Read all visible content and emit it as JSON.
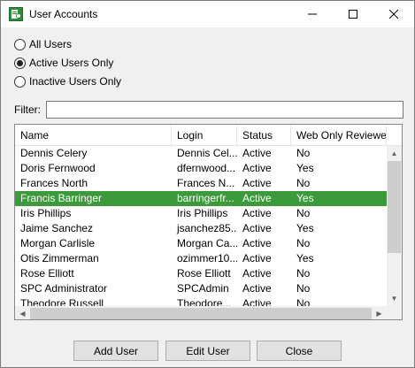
{
  "window": {
    "title": "User Accounts",
    "icon": "user-accounts-app-icon",
    "controls": [
      "minimize-icon",
      "maximize-icon",
      "close-icon"
    ]
  },
  "filters": {
    "options": [
      {
        "label": "All Users",
        "checked": false
      },
      {
        "label": "Active Users Only",
        "checked": true
      },
      {
        "label": "Inactive Users Only",
        "checked": false
      }
    ],
    "filter_label": "Filter:",
    "filter_value": ""
  },
  "table": {
    "columns": [
      "Name",
      "Login",
      "Status",
      "Web Only Reviewer"
    ],
    "rows": [
      {
        "name": "Dennis Celery",
        "login": "Dennis Cel...",
        "status": "Active",
        "reviewer": "No",
        "selected": false
      },
      {
        "name": "Doris Fernwood",
        "login": "dfernwood...",
        "status": "Active",
        "reviewer": "Yes",
        "selected": false
      },
      {
        "name": "Frances North",
        "login": "Frances N...",
        "status": "Active",
        "reviewer": "No",
        "selected": false
      },
      {
        "name": "Francis Barringer",
        "login": "barringerfr...",
        "status": "Active",
        "reviewer": "Yes",
        "selected": true
      },
      {
        "name": "Iris Phillips",
        "login": "Iris Phillips",
        "status": "Active",
        "reviewer": "No",
        "selected": false
      },
      {
        "name": "Jaime Sanchez",
        "login": "jsanchez85...",
        "status": "Active",
        "reviewer": "Yes",
        "selected": false
      },
      {
        "name": "Morgan Carlisle",
        "login": "Morgan Ca...",
        "status": "Active",
        "reviewer": "No",
        "selected": false
      },
      {
        "name": "Otis Zimmerman",
        "login": "ozimmer10...",
        "status": "Active",
        "reviewer": "Yes",
        "selected": false
      },
      {
        "name": "Rose Elliott",
        "login": "Rose Elliott",
        "status": "Active",
        "reviewer": "No",
        "selected": false
      },
      {
        "name": "SPC Administrator",
        "login": "SPCAdmin",
        "status": "Active",
        "reviewer": "No",
        "selected": false
      },
      {
        "name": "Theodore Russell",
        "login": "Theodore...",
        "status": "Active",
        "reviewer": "No",
        "selected": false
      }
    ],
    "selection_color": "#3c9a3c"
  },
  "buttons": {
    "add": "Add User",
    "edit": "Edit User",
    "close": "Close"
  }
}
